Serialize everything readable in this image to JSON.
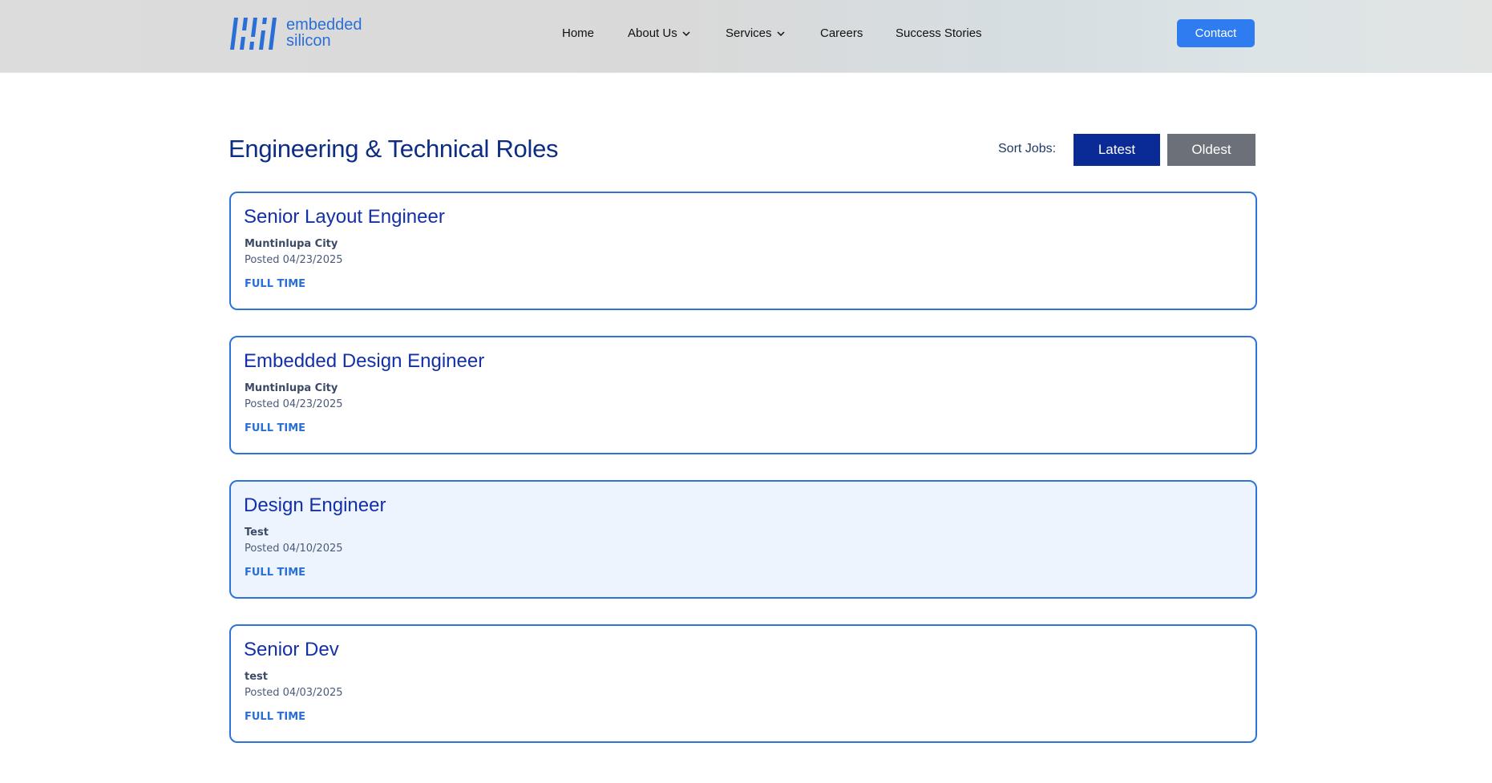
{
  "brand": {
    "logo_line1": "embedded",
    "logo_line2": "silicon",
    "accent_color": "#2f7cf0",
    "heading_color": "#0d2d82"
  },
  "nav": {
    "home": "Home",
    "about": "About Us",
    "services": "Services",
    "careers": "Careers",
    "success": "Success Stories",
    "contact": "Contact"
  },
  "main": {
    "title": "Engineering & Technical Roles",
    "sort_label": "Sort Jobs:",
    "sort_latest": "Latest",
    "sort_oldest": "Oldest"
  },
  "jobs": [
    {
      "title": "Senior Layout Engineer",
      "location": "Muntinlupa City",
      "posted": "Posted 04/23/2025",
      "type": "FULL TIME"
    },
    {
      "title": "Embedded Design Engineer",
      "location": "Muntinlupa City",
      "posted": "Posted 04/23/2025",
      "type": "FULL TIME"
    },
    {
      "title": "Design Engineer",
      "location": "Test",
      "posted": "Posted 04/10/2025",
      "type": "FULL TIME"
    },
    {
      "title": "Senior Dev",
      "location": "test",
      "posted": "Posted 04/03/2025",
      "type": "FULL TIME"
    }
  ]
}
